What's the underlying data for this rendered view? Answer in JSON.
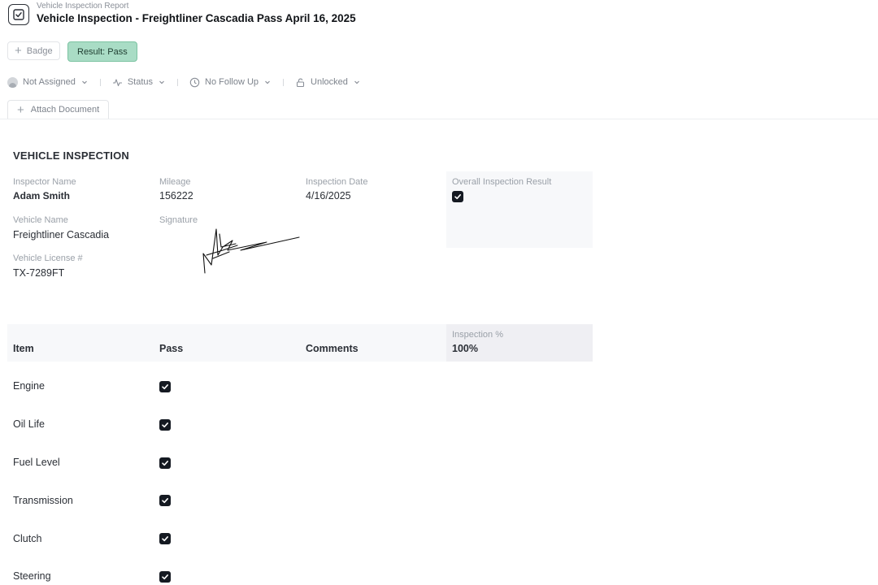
{
  "header": {
    "subtitle": "Vehicle Inspection Report",
    "title": "Vehicle Inspection - Freightliner Cascadia Pass April 16, 2025"
  },
  "actions": {
    "badge_label": "Badge",
    "result_label": "Result: Pass",
    "result_color": "#a9dcc5"
  },
  "toolbar": {
    "assignee": "Not Assigned",
    "status": "Status",
    "follow_up": "No Follow Up",
    "lock": "Unlocked",
    "attach": "Attach Document"
  },
  "inspection": {
    "section_title": "VEHICLE INSPECTION",
    "fields": {
      "inspector_label": "Inspector Name",
      "inspector_value": "Adam Smith",
      "mileage_label": "Mileage",
      "mileage_value": "156222",
      "date_label": "Inspection Date",
      "date_value": "4/16/2025",
      "overall_label": "Overall Inspection Result",
      "overall_checked": true,
      "vehicle_label": "Vehicle Name",
      "vehicle_value": "Freightliner Cascadia",
      "signature_label": "Signature",
      "license_label": "Vehicle License #",
      "license_value": "TX-7289FT"
    }
  },
  "table": {
    "headers": {
      "item": "Item",
      "pass": "Pass",
      "comments": "Comments"
    },
    "percent_label": "Inspection %",
    "percent_value": "100%",
    "rows": [
      {
        "item": "Engine",
        "pass": true,
        "comment": ""
      },
      {
        "item": "Oil Life",
        "pass": true,
        "comment": ""
      },
      {
        "item": "Fuel Level",
        "pass": true,
        "comment": ""
      },
      {
        "item": "Transmission",
        "pass": true,
        "comment": ""
      },
      {
        "item": "Clutch",
        "pass": true,
        "comment": ""
      },
      {
        "item": "Steering",
        "pass": true,
        "comment": ""
      }
    ]
  }
}
